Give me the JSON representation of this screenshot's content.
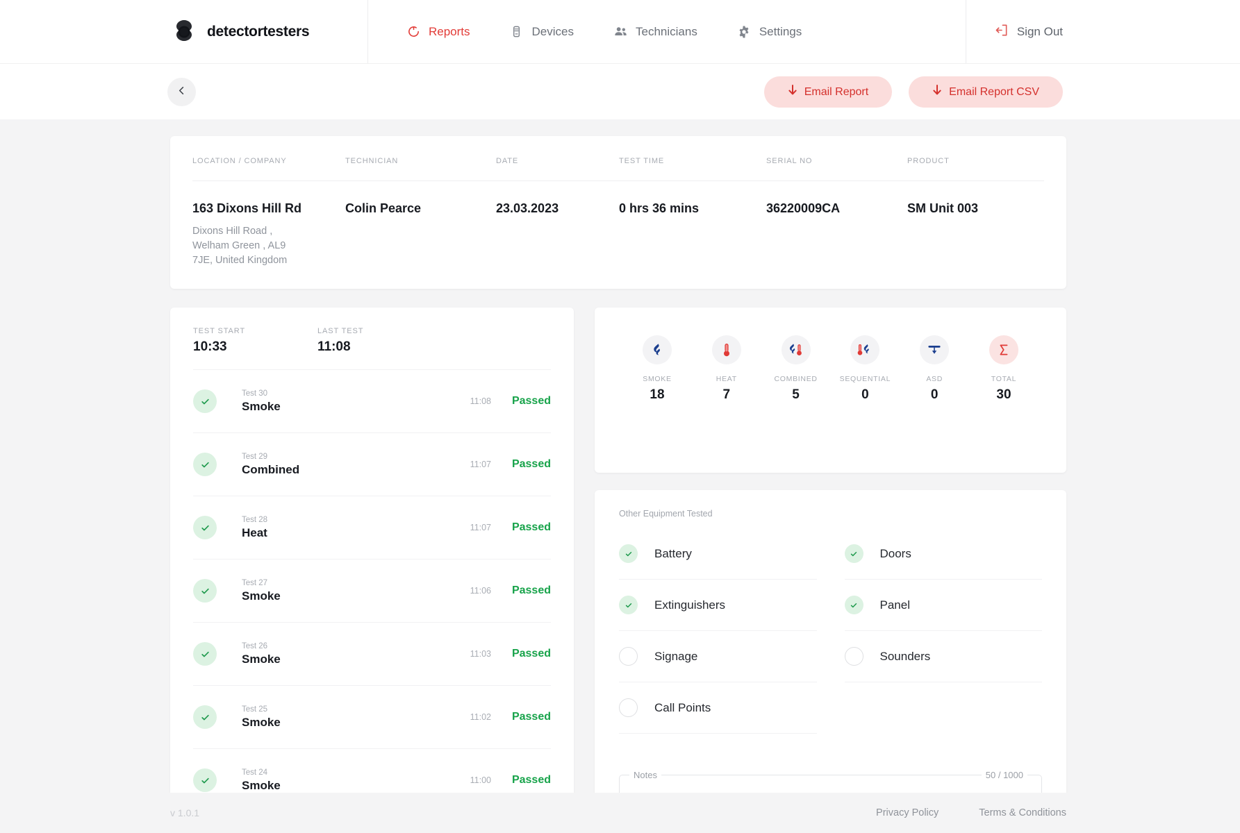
{
  "brand": {
    "name": "detectortesters",
    "logo_icon": "detectortesters-logo-icon"
  },
  "nav": {
    "items": [
      {
        "label": "Reports",
        "icon": "reports-icon",
        "active": true
      },
      {
        "label": "Devices",
        "icon": "devices-icon",
        "active": false
      },
      {
        "label": "Technicians",
        "icon": "technicians-icon",
        "active": false
      },
      {
        "label": "Settings",
        "icon": "gear-icon",
        "active": false
      }
    ],
    "sign_out": {
      "label": "Sign Out",
      "icon": "sign-out-icon"
    }
  },
  "actionbar": {
    "back_icon": "chevron-left-icon",
    "buttons": [
      {
        "label": "Email Report",
        "icon": "download-arrow-icon"
      },
      {
        "label": "Email Report CSV",
        "icon": "download-arrow-icon"
      }
    ]
  },
  "info": {
    "columns": [
      {
        "label": "LOCATION / COMPANY",
        "value": "163 Dixons Hill Rd",
        "sub": "Dixons Hill Road , Welham Green , AL9 7JE, United Kingdom"
      },
      {
        "label": "TECHNICIAN",
        "value": "Colin Pearce",
        "sub": ""
      },
      {
        "label": "DATE",
        "value": "23.03.2023",
        "sub": ""
      },
      {
        "label": "TEST TIME",
        "value": "0 hrs 36 mins",
        "sub": ""
      },
      {
        "label": "SERIAL NO",
        "value": "36220009CA",
        "sub": ""
      },
      {
        "label": "PRODUCT",
        "value": "SM Unit 003",
        "sub": ""
      }
    ]
  },
  "tests": {
    "start_label": "TEST START",
    "start_value": "10:33",
    "last_label": "LAST TEST",
    "last_value": "11:08",
    "rows": [
      {
        "number": "Test 30",
        "name": "Smoke",
        "time": "11:08",
        "status": "Passed"
      },
      {
        "number": "Test 29",
        "name": "Combined",
        "time": "11:07",
        "status": "Passed"
      },
      {
        "number": "Test 28",
        "name": "Heat",
        "time": "11:07",
        "status": "Passed"
      },
      {
        "number": "Test 27",
        "name": "Smoke",
        "time": "11:06",
        "status": "Passed"
      },
      {
        "number": "Test 26",
        "name": "Smoke",
        "time": "11:03",
        "status": "Passed"
      },
      {
        "number": "Test 25",
        "name": "Smoke",
        "time": "11:02",
        "status": "Passed"
      },
      {
        "number": "Test 24",
        "name": "Smoke",
        "time": "11:00",
        "status": "Passed"
      }
    ]
  },
  "stats": {
    "items": [
      {
        "label": "SMOKE",
        "value": "18",
        "icon": "smoke-icon",
        "highlight": false
      },
      {
        "label": "HEAT",
        "value": "7",
        "icon": "heat-icon",
        "highlight": false
      },
      {
        "label": "COMBINED",
        "value": "5",
        "icon": "combined-icon",
        "highlight": false
      },
      {
        "label": "SEQUENTIAL",
        "value": "0",
        "icon": "sequential-icon",
        "highlight": false
      },
      {
        "label": "ASD",
        "value": "0",
        "icon": "asd-icon",
        "highlight": false
      },
      {
        "label": "TOTAL",
        "value": "30",
        "icon": "sigma-icon",
        "highlight": true
      }
    ]
  },
  "equipment": {
    "title": "Other Equipment Tested",
    "items": [
      {
        "label": "Battery",
        "checked": true
      },
      {
        "label": "Doors",
        "checked": true
      },
      {
        "label": "Extinguishers",
        "checked": true
      },
      {
        "label": "Panel",
        "checked": true
      },
      {
        "label": "Signage",
        "checked": false
      },
      {
        "label": "Sounders",
        "checked": false
      },
      {
        "label": "Call Points",
        "checked": false
      }
    ]
  },
  "notes": {
    "legend": "Notes",
    "counter": "50 / 1000",
    "value": "",
    "placeholder": ""
  },
  "footer": {
    "version": "v 1.0.1",
    "links": [
      {
        "label": "Privacy Policy"
      },
      {
        "label": "Terms & Conditions"
      }
    ]
  },
  "colors": {
    "accent": "#e23b37",
    "accent_soft": "#fbdddc",
    "pass": "#17a34a",
    "pass_soft": "#dcf2e2",
    "page_bg": "#f4f4f5"
  }
}
